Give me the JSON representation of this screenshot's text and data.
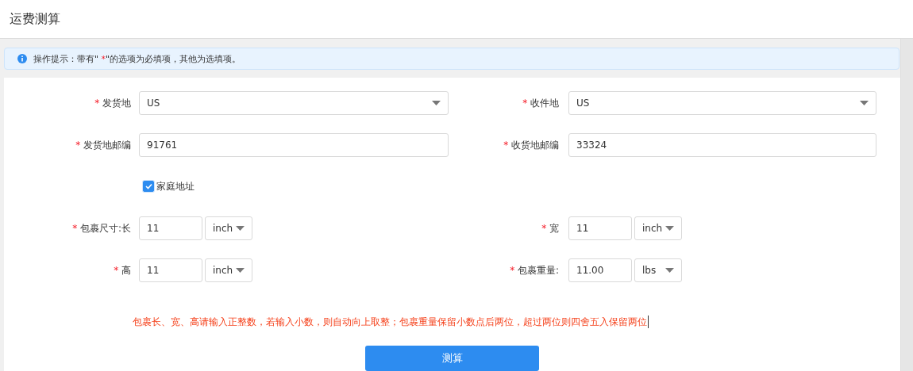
{
  "header": {
    "title": "运费测算"
  },
  "tip": {
    "before": "操作提示：带有\" ",
    "mark": "*",
    "after": "\"的选项为必填项，其他为选填项。"
  },
  "rows": [
    {
      "cells": [
        {
          "kind": "select",
          "required_mark": "*",
          "label": "发货地",
          "value": "US"
        },
        {
          "kind": "select",
          "required_mark": "*",
          "label": "收件地",
          "value": "US"
        }
      ]
    },
    {
      "cells": [
        {
          "kind": "text",
          "required_mark": "*",
          "label": "发货地邮编",
          "value": "91761"
        },
        {
          "kind": "text",
          "required_mark": "*",
          "label": "收货地邮编",
          "value": "33324"
        }
      ]
    },
    {
      "cells": [
        {
          "kind": "checkbox",
          "label": "家庭地址",
          "checked": true
        }
      ]
    },
    {
      "cells": [
        {
          "kind": "measure",
          "required_mark": "*",
          "label": "包裹尺寸:长",
          "value": "11",
          "unit": "inch"
        },
        {
          "kind": "measure",
          "required_mark": "*",
          "label": "宽",
          "value": "11",
          "unit": "inch"
        }
      ]
    },
    {
      "cells": [
        {
          "kind": "measure",
          "required_mark": "*",
          "label": "高",
          "value": "11",
          "unit": "inch"
        },
        {
          "kind": "measure",
          "required_mark": "*",
          "label": "包裹重量:",
          "value": "11.00",
          "unit": "lbs"
        }
      ]
    }
  ],
  "note": "包裹长、宽、高请输入正整数，若输入小数，则自动向上取整；包裹重量保留小数点后两位，超过两位则四舍五入保留两位",
  "submit": {
    "label": "测算"
  }
}
